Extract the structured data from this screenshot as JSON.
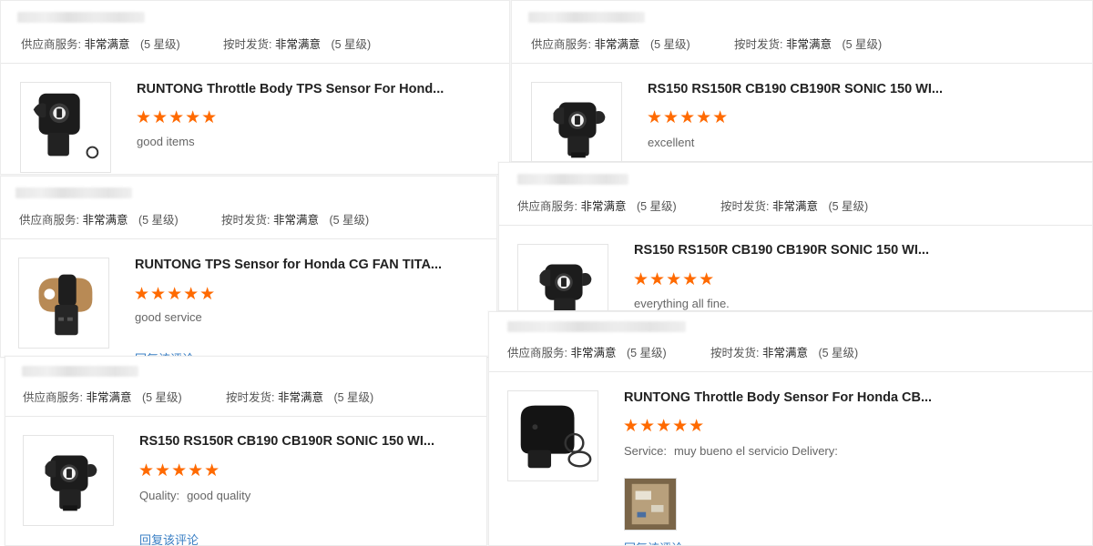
{
  "ratings_labels": {
    "supplier_service": "供应商服务:",
    "on_time_delivery": "按时发货:",
    "value": "非常满意",
    "level": "(5 星级)"
  },
  "reviews": [
    {
      "title": "RUNTONG Throttle Body TPS Sensor For Hond...",
      "stars": "★★★★★",
      "rating_value": 5,
      "review_label": "",
      "review_text": "good items",
      "reply": "",
      "product_image": "black-tps-sensor-with-o-ring"
    },
    {
      "title": "RS150 RS150R CB190 CB190R SONIC 150 WI...",
      "stars": "★★★★★",
      "rating_value": 5,
      "review_label": "",
      "review_text": "excellent",
      "reply": "",
      "product_image": "black-tps-sensor"
    },
    {
      "title": "RUNTONG TPS Sensor for Honda CG FAN TITA...",
      "stars": "★★★★★",
      "rating_value": 5,
      "review_label": "",
      "review_text": "good service",
      "reply": "回复该评论",
      "product_image": "tan-tps-sensor"
    },
    {
      "title": "RS150 RS150R CB190 CB190R SONIC 150 WI...",
      "stars": "★★★★★",
      "rating_value": 5,
      "review_label": "",
      "review_text": "everything all fine.",
      "reply": "",
      "product_image": "black-tps-sensor"
    },
    {
      "title": "RS150 RS150R CB190 CB190R SONIC 150 WI...",
      "stars": "★★★★★",
      "rating_value": 5,
      "review_label": "Quality:",
      "review_text": "good quality",
      "reply": "回复该评论",
      "product_image": "black-tps-sensor"
    },
    {
      "title": "RUNTONG Throttle Body Sensor For Honda CB...",
      "stars": "★★★★★",
      "rating_value": 5,
      "review_label": "Service:",
      "review_text": "muy bueno el servicio Delivery:",
      "reply": "回复该评论",
      "product_image": "black-throttle-body-sensor-with-o-rings",
      "buyer_photo": "package-photo"
    }
  ],
  "colors": {
    "star": "#ff6a00",
    "link": "#3a7fc4",
    "title": "#222222",
    "muted": "#666666"
  }
}
